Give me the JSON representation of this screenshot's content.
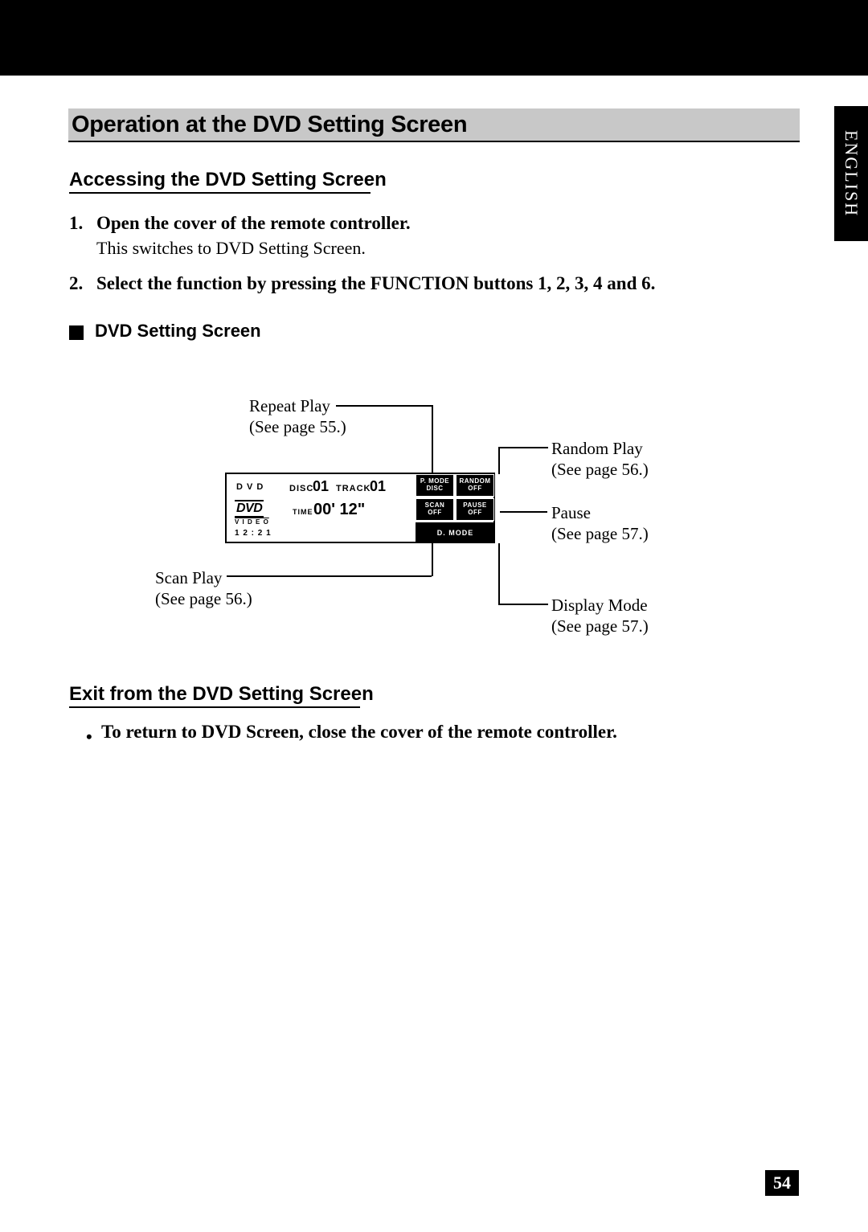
{
  "language_tab": "ENGLISH",
  "page_number": "54",
  "heading_main": "Operation at the DVD Setting Screen",
  "heading_access": "Accessing the DVD Setting Screen",
  "step1_num": "1.",
  "step1_bold": "Open the cover of the remote controller.",
  "step1_desc": "This switches to DVD Setting Screen.",
  "step2_num": "2.",
  "step2_bold": "Select the function by pressing the FUNCTION buttons 1, 2, 3, 4 and 6.",
  "sub_heading": "DVD Setting Screen",
  "callout_repeat_l1": "Repeat Play",
  "callout_repeat_l2": "(See page 55.)",
  "callout_scan_l1": "Scan Play",
  "callout_scan_l2": "(See page 56.)",
  "callout_random_l1": "Random Play",
  "callout_random_l2": "(See page 56.)",
  "callout_pause_l1": "Pause",
  "callout_pause_l2": "(See page 57.)",
  "callout_dmode_l1": "Display Mode",
  "callout_dmode_l2": "(See page 57.)",
  "lcd": {
    "dvd_label": "D V D",
    "disc_label": "DISC",
    "disc_num": "01",
    "track_label": "TRACK",
    "track_num": "01",
    "dvd_logo": "DVD",
    "video_label": "V I D E O",
    "clock": "1 2 : 2 1",
    "time_label": "TIME",
    "time_value": "00' 12\"",
    "sk_pmode_1": "P. MODE",
    "sk_pmode_2": "DISC",
    "sk_random_1": "RANDOM",
    "sk_random_2": "OFF",
    "sk_scan_1": "SCAN",
    "sk_scan_2": "OFF",
    "sk_pause_1": "PAUSE",
    "sk_pause_2": "OFF",
    "sk_dmode": "D. MODE"
  },
  "heading_exit": "Exit from the DVD Setting Screen",
  "exit_bullet": "To return to DVD Screen, close the cover of the remote controller."
}
